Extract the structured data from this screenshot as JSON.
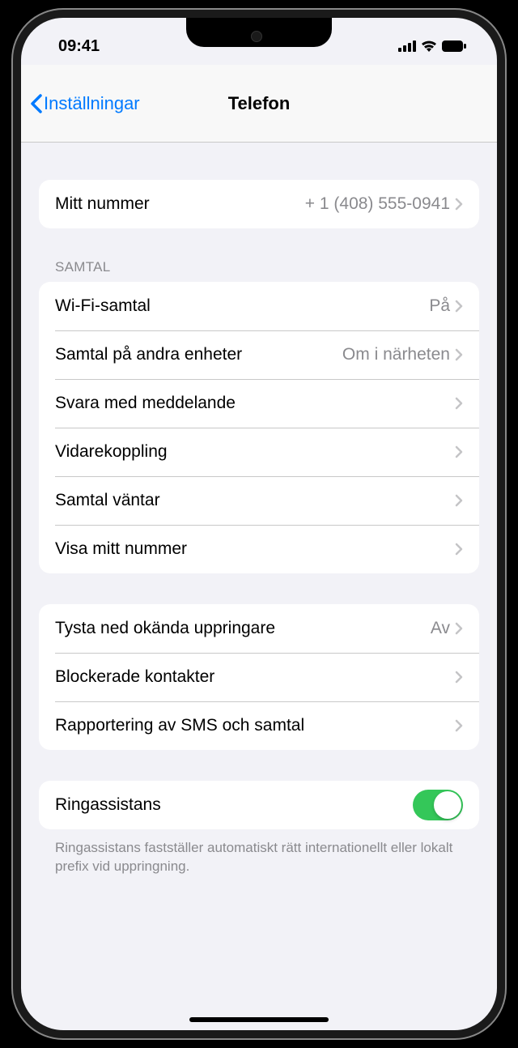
{
  "status": {
    "time": "09:41"
  },
  "nav": {
    "back_label": "Inställningar",
    "title": "Telefon"
  },
  "sections": {
    "my_number": {
      "label": "Mitt nummer",
      "value": "+ 1 (408) 555-0941"
    },
    "calls_header": "Samtal",
    "wifi_calling": {
      "label": "Wi-Fi-samtal",
      "value": "På"
    },
    "other_devices": {
      "label": "Samtal på andra enheter",
      "value": "Om i närheten"
    },
    "respond_text": {
      "label": "Svara med meddelande"
    },
    "forwarding": {
      "label": "Vidarekoppling"
    },
    "call_waiting": {
      "label": "Samtal väntar"
    },
    "show_caller_id": {
      "label": "Visa mitt nummer"
    },
    "silence_unknown": {
      "label": "Tysta ned okända uppringare",
      "value": "Av"
    },
    "blocked": {
      "label": "Blockerade kontakter"
    },
    "reporting": {
      "label": "Rapportering av SMS och samtal"
    },
    "dial_assist": {
      "label": "Ringassistans",
      "footer": "Ringassistans fastställer automatiskt rätt internationellt eller lokalt prefix vid uppringning."
    }
  }
}
